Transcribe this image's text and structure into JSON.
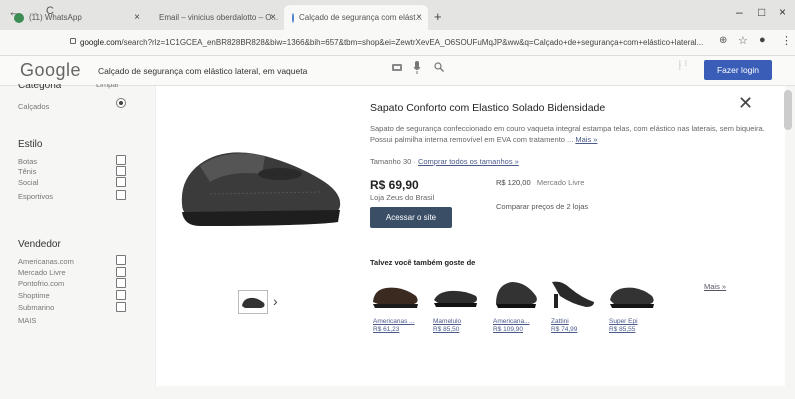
{
  "tabs": [
    {
      "label": "(11) WhatsApp",
      "close": "×",
      "color": "#3c8c54"
    },
    {
      "label": "Email – vinicius oberdalotto – O...",
      "close": "×",
      "color": "#2d6fb5"
    },
    {
      "label": "Calçado de segurança com elást...",
      "close": "×",
      "color": "#4a7bd0"
    }
  ],
  "new_tab": "+",
  "window": {
    "minimize": "–",
    "maximize": "□",
    "close": "×"
  },
  "nav": {
    "back": "←",
    "forward": "→",
    "reload": "C"
  },
  "address": {
    "host": "google.com",
    "path": "/search?rlz=1C1GCEA_enBR828BR828&biw=1366&bih=657&tbm=shop&ei=ZewtrXevEA_O6SOUFuMqJP&ww&q=Calçado+de+segurança+com+elástico+lateral..."
  },
  "toolbar_icons": {
    "ext": "⊕",
    "star": "☆",
    "account": "●",
    "menu": "⋮"
  },
  "google": {
    "logo": "Google",
    "query": "Calçado de segurança com elástico lateral, em vaqueta",
    "apps_icon": "⋮⋮⋮",
    "login": "Fazer login"
  },
  "sidebar": {
    "top_cut": [
      "Categoria",
      "Limpar"
    ],
    "categoria_item": "Calçados",
    "estilo_head": "Estilo",
    "estilo_items": [
      "Botas",
      "Tênis",
      "Social",
      "Esportivos"
    ],
    "vendedor_head": "Vendedor",
    "vendedor_items": [
      "Americanas.com",
      "Mercado Livre",
      "Pontofrio.com",
      "Shoptime",
      "Submarino"
    ],
    "more": "MAIS"
  },
  "panel": {
    "title": "Sapato Conforto com Elastico Solado Bidensidade",
    "close": "✕",
    "description": "Sapato de segurança confeccionado em couro vaqueta integral estampa telas, com elástico nas laterais, sem biqueira. Possui palmilha interna removível em EVA com tratamento ...",
    "description_more": "Mais »",
    "size_label": "Tamanho",
    "size_value": "30",
    "size_link": "Comprar todos os tamanhos »",
    "price": "R$ 69,90",
    "store": "Loja Zeus do Brasil",
    "visit": "Acessar o site",
    "other_price": "R$ 120,00",
    "other_store": "Mercado Livre",
    "compare": "Comparar preços de 2 lojas",
    "thumb_next": "›",
    "related_head": "Talvez você também goste de",
    "related": [
      {
        "store": "Americanas ...",
        "price": "R$ 61,23"
      },
      {
        "store": "Mamelulo",
        "price": "R$ 85,50"
      },
      {
        "store": "Americana...",
        "price": "R$ 109,90"
      },
      {
        "store": "Zattini",
        "price": "R$ 74,99"
      },
      {
        "store": "Super Epi",
        "price": "R$ 85,55"
      }
    ],
    "more_link": "Mais »"
  }
}
